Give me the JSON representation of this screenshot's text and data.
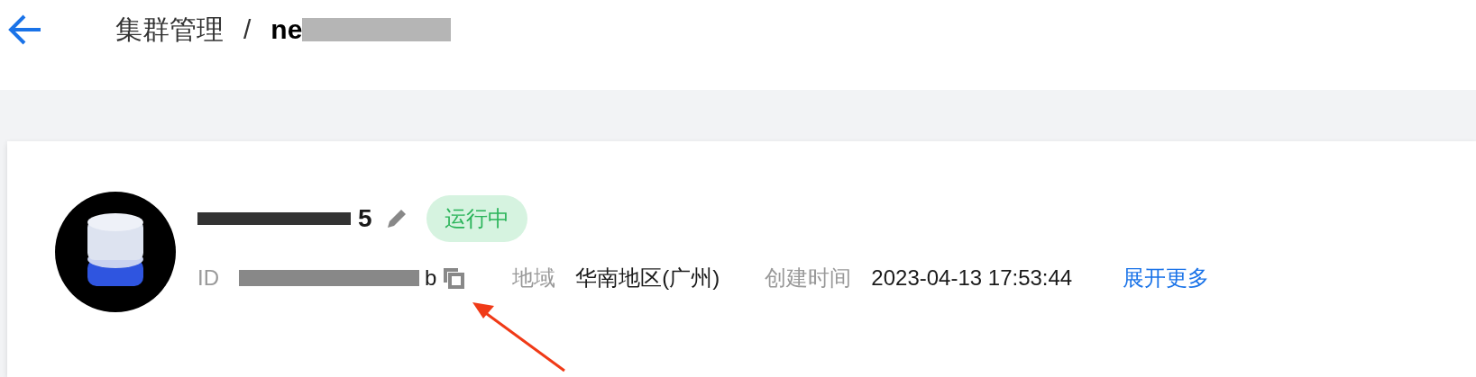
{
  "header": {
    "back": true,
    "breadcrumb": {
      "parent": "集群管理",
      "separator": "/",
      "current": "ne",
      "redacted": true
    }
  },
  "cluster": {
    "name": "5",
    "name_redacted": true,
    "editable": true,
    "status": {
      "label": "运行中",
      "kind": "running"
    },
    "id_label": "ID",
    "id_value": "b",
    "id_redacted": true,
    "copyable": true,
    "fields": [
      {
        "label": "地域",
        "value": "华南地区(广州)"
      },
      {
        "label": "创建时间",
        "value": "2023-04-13 17:53:44"
      }
    ],
    "expand_link": "展开更多"
  },
  "annotation": {
    "kind": "arrow"
  }
}
